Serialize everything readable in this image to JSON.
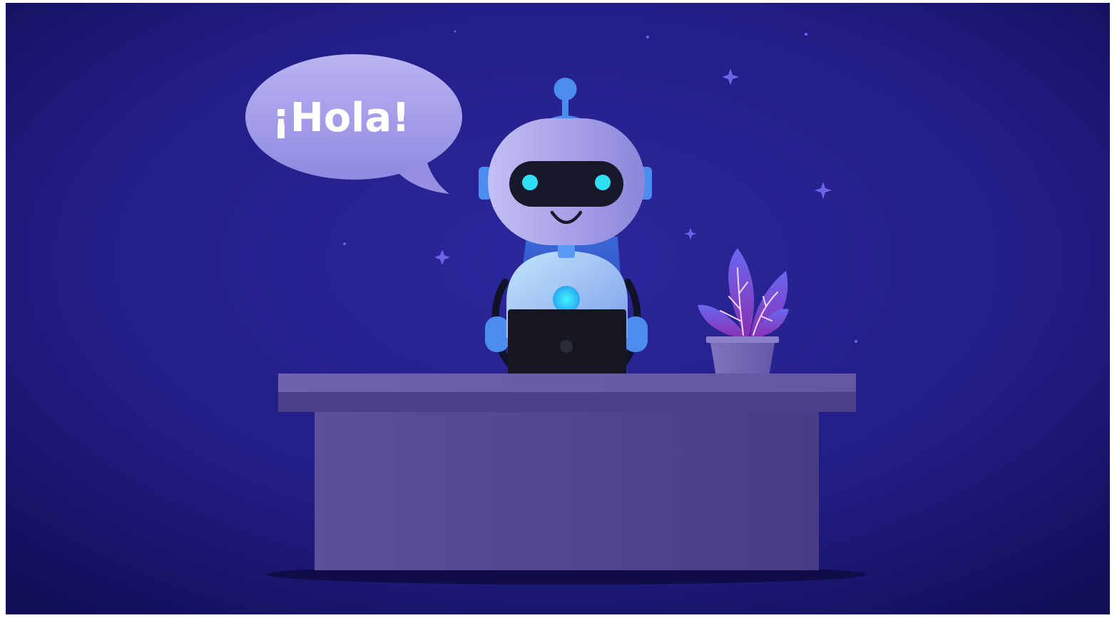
{
  "scene": {
    "speech_bubble_text": "¡Hola!",
    "colors": {
      "background_center": "#2a2598",
      "background_edge": "#14105e",
      "robot_body": "#b7b3f0",
      "robot_accent": "#4c8cf0",
      "robot_eyes": "#2fe0f4",
      "visor": "#17182a",
      "desk_top": "#6a5aa8",
      "desk_front": "#564a94",
      "plant_leaves": "#5a54e8",
      "bubble": "#a9a4ec"
    },
    "icons": [
      "robot-icon",
      "laptop-icon",
      "plant-icon",
      "speech-bubble-icon",
      "sparkle-icon"
    ]
  }
}
